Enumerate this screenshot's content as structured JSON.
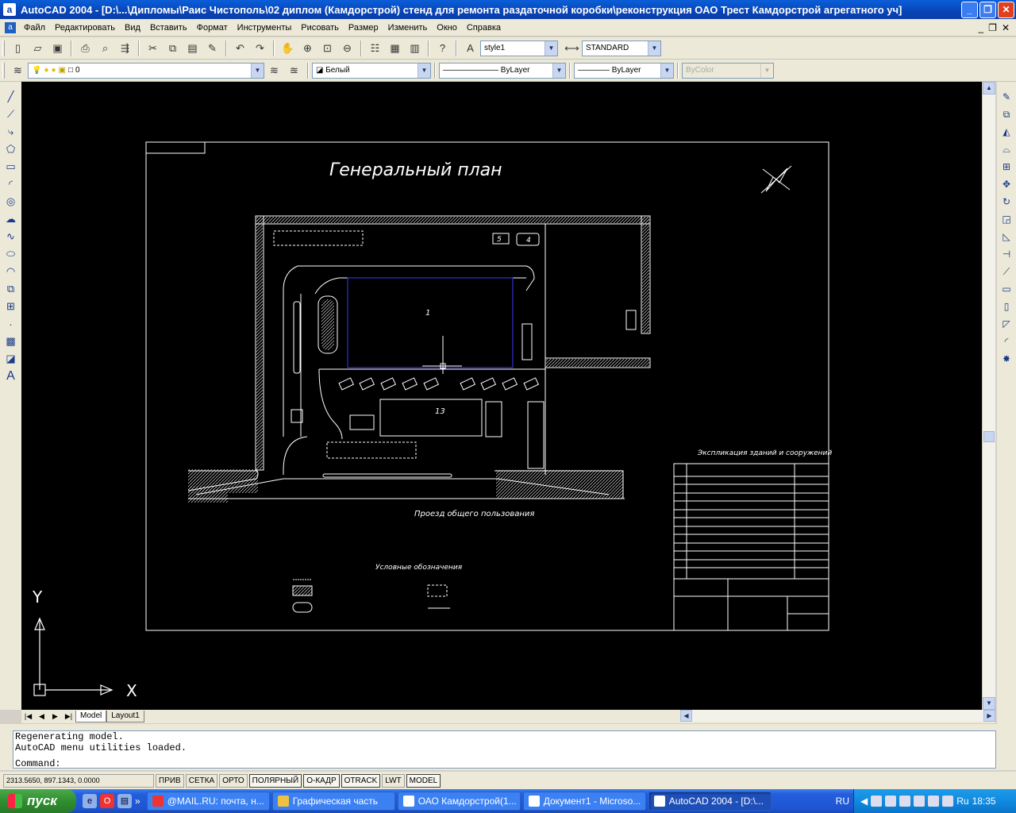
{
  "window": {
    "title": "AutoCAD 2004 - [D:\\...\\Дипломы\\Раис Чистополь\\02 диплом (Камдорстрой) стенд для ремонта раздаточной коробки\\реконструкция ОАО Трест Камдорстрой агрегатного уч]",
    "minimize": "_",
    "restore": "❐",
    "close": "✕"
  },
  "menu": {
    "items": [
      "Файл",
      "Редактировать",
      "Вид",
      "Вставить",
      "Формат",
      "Инструменты",
      "Рисовать",
      "Размер",
      "Изменить",
      "Окно",
      "Справка"
    ]
  },
  "toolbar": {
    "text_style": "style1",
    "dim_style": "STANDARD",
    "layer": "0",
    "color": "Белый",
    "linetype": "ByLayer",
    "lineweight": "ByLayer",
    "plotstyle": "ByColor"
  },
  "drawing": {
    "title": "Генеральный план",
    "road_label": "Проезд общего пользования",
    "legend_title": "Условные обозначения",
    "explication_title": "Экспликация зданий и сооружений",
    "building_1": "1",
    "building_13": "13",
    "building_4": "4",
    "building_5": "5",
    "ucs_x": "X",
    "ucs_y": "Y"
  },
  "tabs": {
    "model": "Model",
    "layout": "Layout1"
  },
  "command": {
    "line1": "Regenerating model.",
    "line2": "AutoCAD menu utilities loaded.",
    "prompt": "Command:"
  },
  "status": {
    "coords": "2313.5650, 897.1343, 0.0000",
    "buttons": [
      "ПРИВ",
      "СЕТКА",
      "ОРТО",
      "ПОЛЯРНЫЙ",
      "О-КАДР",
      "OTRACK",
      "LWT",
      "MODEL"
    ]
  },
  "taskbar": {
    "start": "пуск",
    "tasks": [
      "@MAIL.RU: почта, н...",
      "Графическая часть",
      "ОАО Камдорстрой(1...",
      "Документ1 - Microso...",
      "AutoCAD 2004 - [D:\\..."
    ],
    "lang": "RU",
    "clock": "18:35"
  },
  "colors": {
    "canvas": "#000000",
    "drawing": "#ffffff",
    "blue_outline": "#3030ff",
    "title_active": "#0a50d0"
  }
}
